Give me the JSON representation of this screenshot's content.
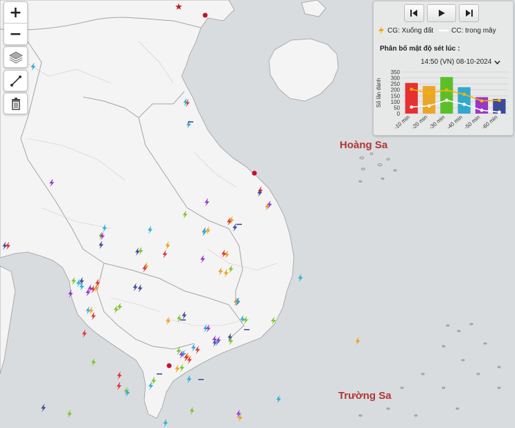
{
  "labels": {
    "hoang_sa": "Hoàng Sa",
    "truong_sa": "Trường Sa"
  },
  "controls": {
    "zoom_in": "+",
    "zoom_out": "−",
    "icons": [
      "layers-icon",
      "measure-line-icon",
      "trash-icon"
    ]
  },
  "panel": {
    "legend_cg": "CG: Xuống đất",
    "legend_cc": "CC: trong mây",
    "title": "Phân bố mật độ sét lúc :",
    "time": "14:50 (VN) 08-10-2024"
  },
  "colors": {
    "land": "#f4f4f4",
    "sea": "#d9dcdf",
    "border": "#a9a9a9",
    "label": "#b23535",
    "cg_line": "#f5b400",
    "cc_line": "#ffffff"
  },
  "chart_data": {
    "type": "bar",
    "ylabel": "Số lần đánh",
    "categories": [
      "-10 min",
      "-20 min",
      "-30 min",
      "-40 min",
      "-50 min",
      "-60 min"
    ],
    "ylim": [
      0,
      350
    ],
    "yticks": [
      0,
      50,
      100,
      150,
      200,
      250,
      300,
      350
    ],
    "bar_colors": [
      "#e5312f",
      "#eba62a",
      "#5cbf2a",
      "#33a8cc",
      "#9a36c9",
      "#3d4a9a"
    ],
    "series": [
      {
        "type": "bar",
        "values": [
          258,
          232,
          308,
          222,
          138,
          123
        ]
      },
      {
        "type": "line",
        "values": [
          205,
          172,
          198,
          162,
          107,
          112
        ]
      },
      {
        "type": "line",
        "values": [
          55,
          65,
          112,
          78,
          28,
          12
        ]
      }
    ]
  }
}
